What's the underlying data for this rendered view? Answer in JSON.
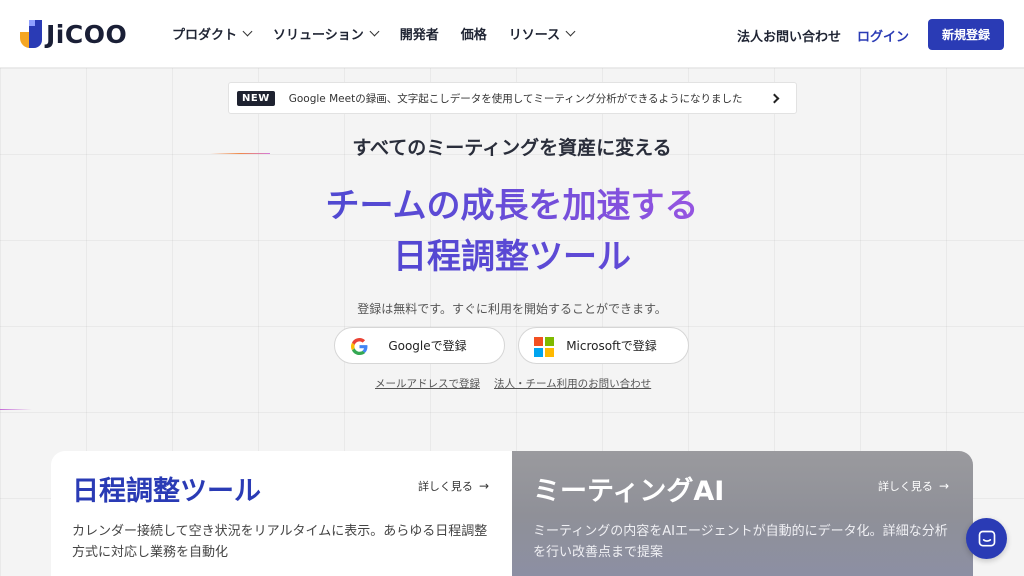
{
  "header": {
    "logo_text": "JiCOO",
    "nav": [
      {
        "label": "プロダクト",
        "has_menu": true
      },
      {
        "label": "ソリューション",
        "has_menu": true
      },
      {
        "label": "開発者",
        "has_menu": false
      },
      {
        "label": "価格",
        "has_menu": false
      },
      {
        "label": "リソース",
        "has_menu": true
      }
    ],
    "contact": "法人お問い合わせ",
    "login": "ログイン",
    "signup": "新規登録"
  },
  "news": {
    "badge": "NEW",
    "text": "Google Meetの録画、文字起こしデータを使用してミーティング分析ができるようになりました"
  },
  "hero": {
    "subtitle": "すべてのミーティングを資産に変える",
    "headline_1": "チームの成長を加速する",
    "headline_2": "日程調整ツール",
    "free_note": "登録は無料です。すぐに利用を開始することができます。",
    "google_signup": "Googleで登録",
    "microsoft_signup": "Microsoftで登録",
    "email_signup": "メールアドレスで登録",
    "corporate_contact": "法人・チーム利用のお問い合わせ"
  },
  "cards": {
    "scheduling": {
      "title": "日程調整ツール",
      "more": "詳しく見る",
      "desc": "カレンダー接続して空き状況をリアルタイムに表示。あらゆる日程調整方式に対応し業務を自動化"
    },
    "meeting_ai": {
      "title": "ミーティングAI",
      "more": "詳しく見る",
      "desc": "ミーティングの内容をAIエージェントが自動的にデータ化。詳細な分析を行い改善点まで提案"
    }
  },
  "colors": {
    "brand": "#2a3bb5",
    "accent_orange": "#f5a623",
    "news_badge": "#1e2230"
  },
  "icons": {
    "google": "google-logo-icon",
    "microsoft": "microsoft-logo-icon",
    "chat": "chat-bubble-icon"
  }
}
